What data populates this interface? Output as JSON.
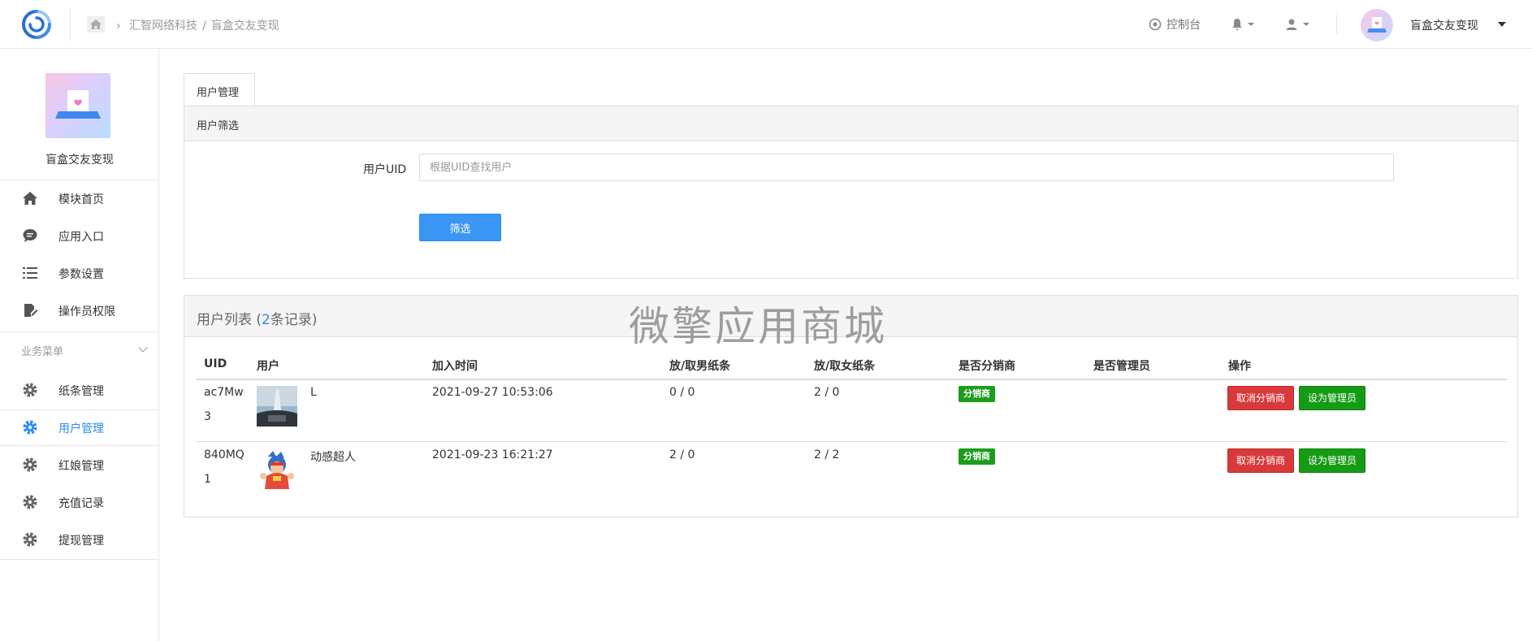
{
  "header": {
    "breadcrumb": [
      "汇智网络科技",
      "/",
      "盲盒交友变现"
    ],
    "console_label": "控制台",
    "user_name": "盲盒交友变现"
  },
  "sidebar": {
    "title": "盲盒交友变现",
    "items": [
      {
        "label": "模块首页",
        "icon": "home-icon"
      },
      {
        "label": "应用入口",
        "icon": "chat-icon"
      },
      {
        "label": "参数设置",
        "icon": "list-icon"
      },
      {
        "label": "操作员权限",
        "icon": "edit-icon"
      }
    ],
    "group_label": "业务菜单",
    "group_items": [
      {
        "label": "纸条管理",
        "icon": "gear-icon"
      },
      {
        "label": "用户管理",
        "icon": "gear-icon",
        "active": true
      },
      {
        "label": "红娘管理",
        "icon": "gear-icon"
      },
      {
        "label": "充值记录",
        "icon": "gear-icon"
      },
      {
        "label": "提现管理",
        "icon": "gear-icon"
      }
    ]
  },
  "main": {
    "tab": "用户管理",
    "filter": {
      "title": "用户筛选",
      "uid_label": "用户UID",
      "uid_placeholder": "根据UID查找用户",
      "uid_value": "",
      "submit_label": "筛选"
    },
    "list": {
      "title_prefix": "用户列表 (",
      "count": "2",
      "title_suffix": "条记录)",
      "columns": [
        "UID",
        "用户",
        "加入时间",
        "放/取男纸条",
        "放/取女纸条",
        "是否分销商",
        "是否管理员",
        "操作"
      ],
      "rows": [
        {
          "uid": "ac7Mw3",
          "nickname": "L",
          "join_time": "2021-09-27 10:53:06",
          "male_notes": "0 / 0",
          "female_notes": "2 / 0",
          "distributor_badge": "分销商",
          "admin": "",
          "actions": [
            "取消分销商",
            "设为管理员"
          ]
        },
        {
          "uid": "840MQ1",
          "nickname": "动感超人",
          "join_time": "2021-09-23 16:21:27",
          "male_notes": "2 / 0",
          "female_notes": "2 / 2",
          "distributor_badge": "分销商",
          "admin": "",
          "actions": [
            "取消分销商",
            "设为管理员"
          ]
        }
      ]
    }
  },
  "watermark": "微擎应用商城",
  "colors": {
    "accent": "#2d8cf0",
    "danger": "#d9393a",
    "success": "#159c15"
  }
}
